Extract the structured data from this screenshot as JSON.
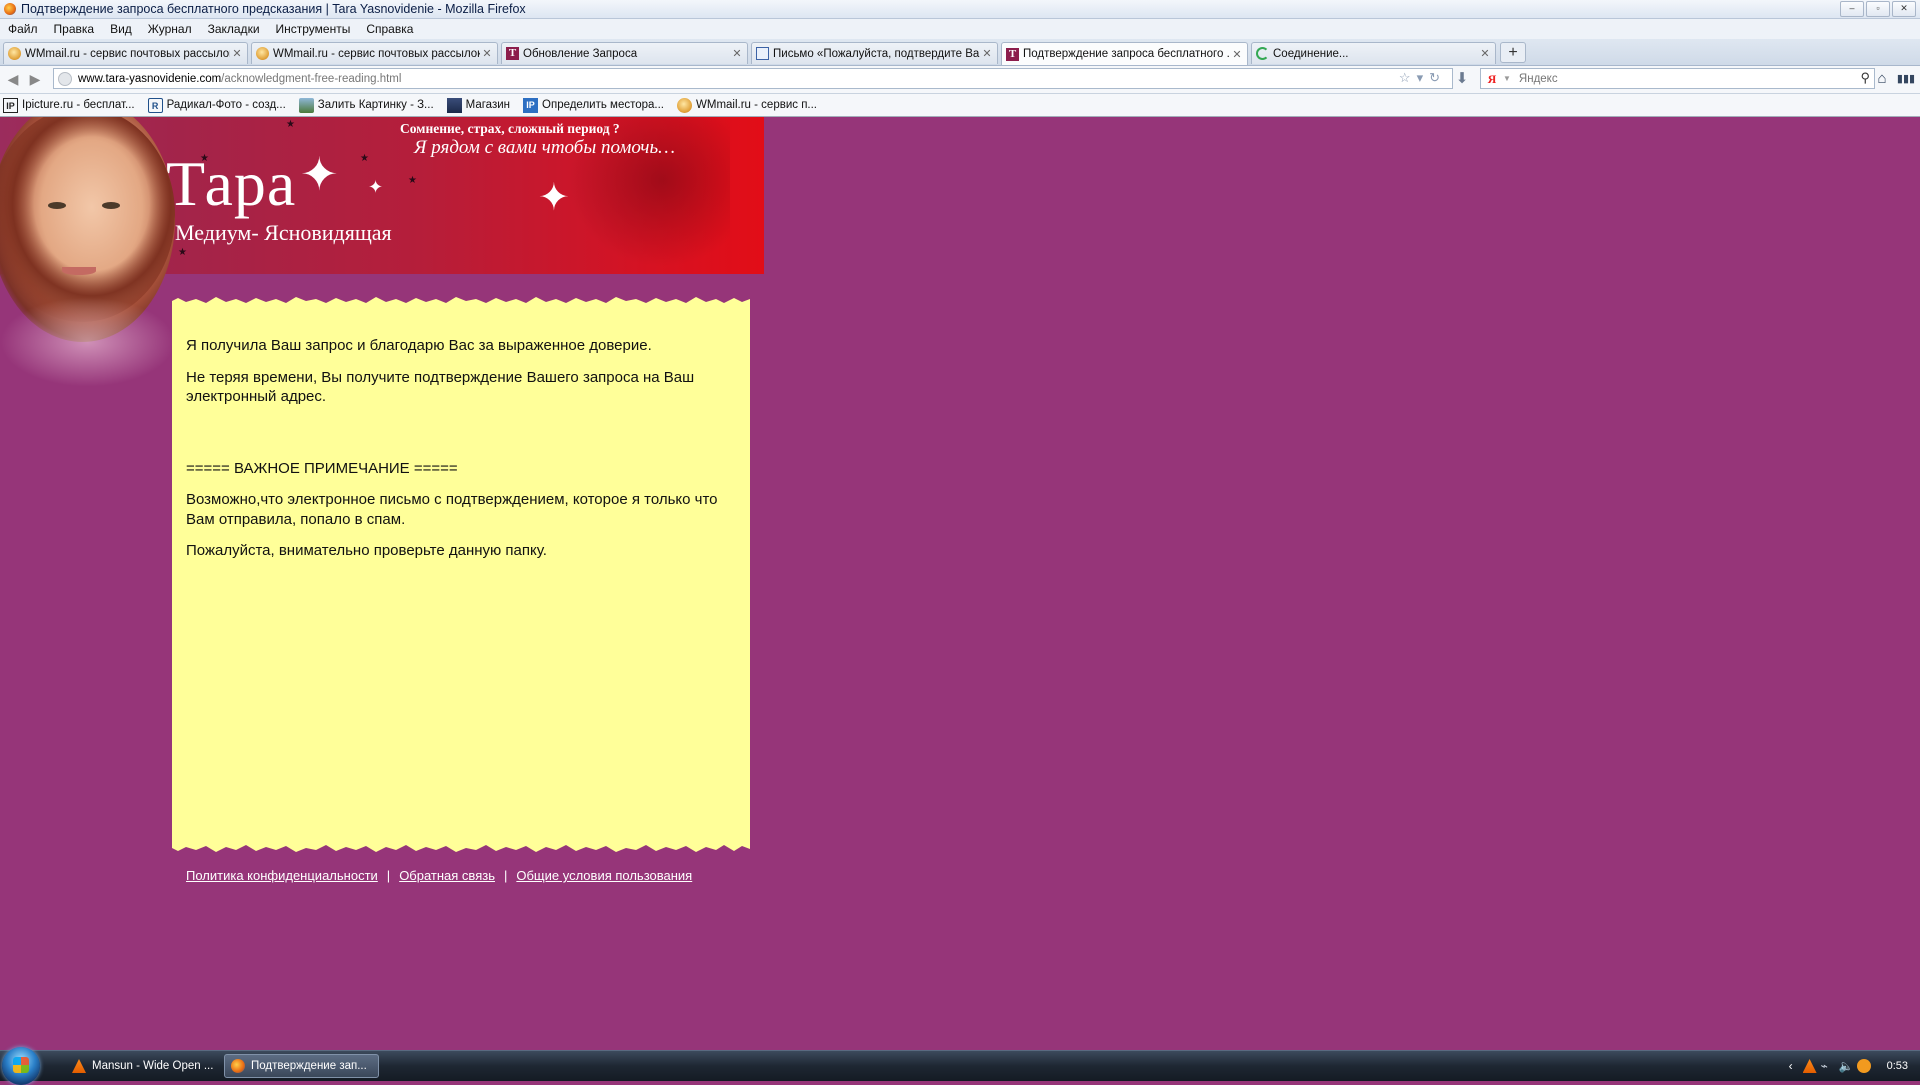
{
  "window": {
    "title": "Подтверждение запроса бесплатного предсказания | Tara Yasnovidenie - Mozilla Firefox"
  },
  "menu": [
    "Файл",
    "Правка",
    "Вид",
    "Журнал",
    "Закладки",
    "Инструменты",
    "Справка"
  ],
  "tabs": [
    {
      "label": "WMmail.ru - сервис почтовых рассылок...",
      "icon": "wmmail-icon",
      "active": false
    },
    {
      "label": "WMmail.ru - сервис почтовых рассылок...",
      "icon": "wmmail-icon",
      "active": false
    },
    {
      "label": "Обновление Запроса",
      "icon": "tara-favicon",
      "active": false
    },
    {
      "label": "Письмо «Пожалуйста, подтвердите Ва...",
      "icon": "mail-icon",
      "active": false
    },
    {
      "label": "Подтверждение запроса бесплатного ...",
      "icon": "tara-favicon",
      "active": true
    },
    {
      "label": "Соединение...",
      "icon": "loading-icon",
      "active": false
    }
  ],
  "new_tab_label": "+",
  "address": {
    "host": "www.tara-yasnovidenie.com",
    "path": "/acknowledgment-free-reading.html"
  },
  "search": {
    "placeholder": "Яндекс"
  },
  "bookmarks": [
    {
      "label": "Ipicture.ru - бесплат...",
      "icon": "ipicture-icon"
    },
    {
      "label": "Радикал-Фото - созд...",
      "icon": "radikal-icon"
    },
    {
      "label": "Залить Картинку - З...",
      "icon": "picture-icon"
    },
    {
      "label": "Магазин",
      "icon": "shop-icon"
    },
    {
      "label": "Определить местора...",
      "icon": "ip-icon"
    },
    {
      "label": "WMmail.ru - сервис п...",
      "icon": "wmmail-icon"
    }
  ],
  "banner": {
    "name": "Тара",
    "subtitle": "Медиум- Ясновидящая",
    "tagline1": "Сомнение, страх, сложный период ?",
    "tagline2": "Я рядом с вами чтобы помочь…"
  },
  "content": {
    "p1": "Я получила Ваш запрос и благодарю Вас за выраженное доверие.",
    "p2": "Не теряя времени, Вы получите подтверждение Вашего запроса на Ваш электронный адрес.",
    "note_heading": "===== ВАЖНОЕ ПРИМЕЧАНИЕ =====",
    "p3": "Возможно,что электронное письмо с подтверждением, которое я только что Вам отправила, попало в спам.",
    "p4": "Пожалуйста, внимательно проверьте данную папку."
  },
  "footer": {
    "privacy": "Политика конфиденциальности",
    "feedback": "Обратная связь",
    "terms": "Общие условия пользования",
    "separator": "|"
  },
  "taskbar": {
    "tasks": [
      {
        "label": "Mansun - Wide Open ...",
        "icon": "vlc-icon",
        "active": false
      },
      {
        "label": "Подтверждение зап...",
        "icon": "firefox-icon",
        "active": true
      }
    ],
    "clock": "0:53"
  },
  "colors": {
    "page_bg": "#963579",
    "content_bg": "#ffff99",
    "banner_red": "#e20d17"
  }
}
